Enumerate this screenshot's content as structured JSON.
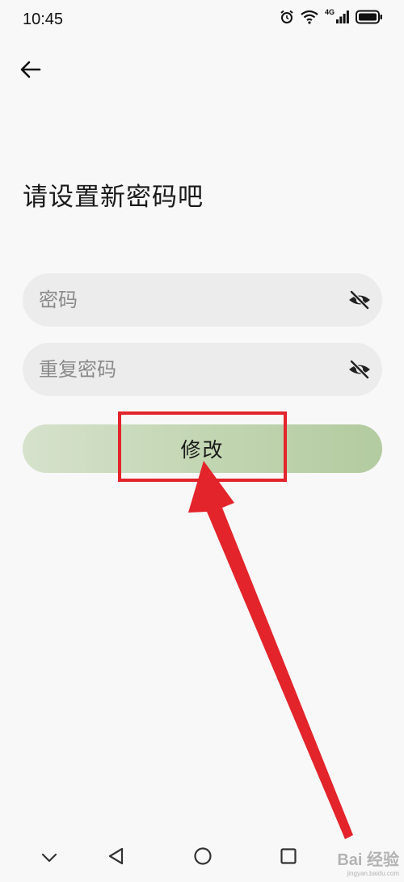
{
  "status_bar": {
    "time": "10:45",
    "network_label": "4G",
    "icons": [
      "alarm-icon",
      "wifi-icon",
      "signal-icon",
      "battery-icon"
    ]
  },
  "header": {
    "back_icon": "arrow-left-icon"
  },
  "page": {
    "title": "请设置新密码吧"
  },
  "form": {
    "password": {
      "placeholder": "密码",
      "value": "",
      "toggle_icon": "eye-hidden-icon"
    },
    "confirm_password": {
      "placeholder": "重复密码",
      "value": "",
      "toggle_icon": "eye-hidden-icon"
    },
    "submit_label": "修改"
  },
  "annotation": {
    "highlight_color": "#e3242b"
  },
  "nav_bar": {
    "icons": [
      "chevron-down-icon",
      "back-triangle-icon",
      "home-circle-icon",
      "recents-square-icon"
    ]
  },
  "watermark": {
    "main": "Bai 经验",
    "sub": "jingyan.baidu.com"
  },
  "colors": {
    "button_start": "#d6e2cc",
    "button_end": "#b3cba0",
    "field_bg": "#ececec",
    "background": "#f8f8f8"
  }
}
